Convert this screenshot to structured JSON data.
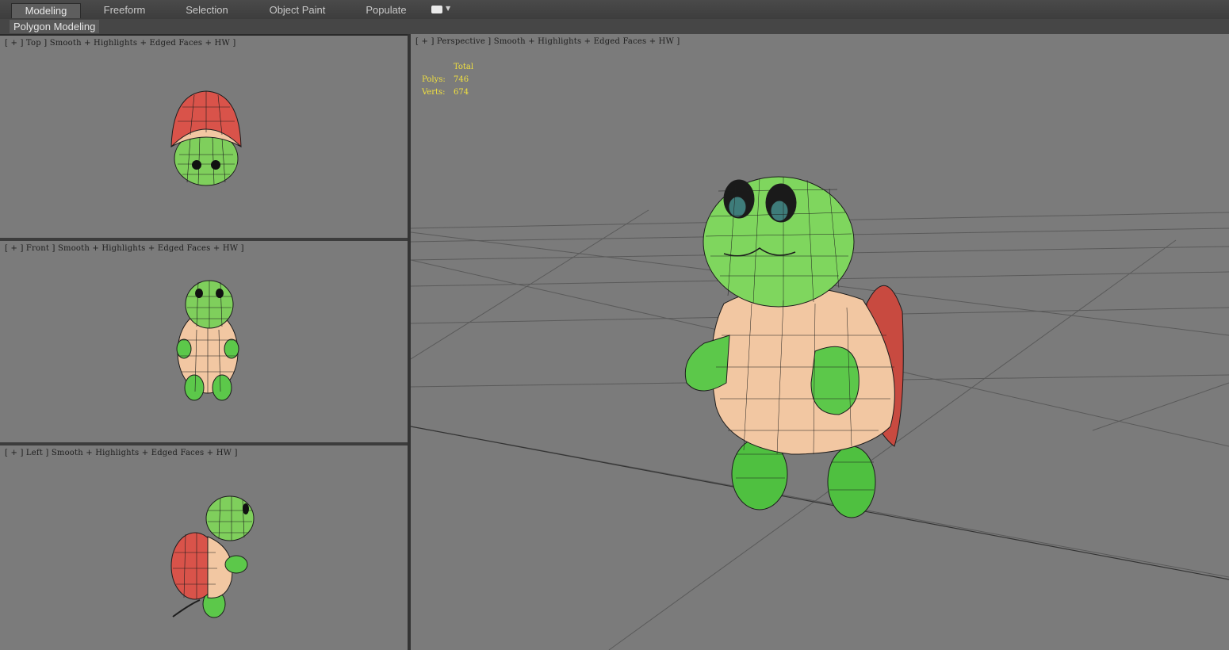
{
  "ribbon": {
    "tabs": [
      {
        "label": "Modeling",
        "active": true
      },
      {
        "label": "Freeform",
        "active": false
      },
      {
        "label": "Selection",
        "active": false
      },
      {
        "label": "Object Paint",
        "active": false
      },
      {
        "label": "Populate",
        "active": false
      }
    ],
    "panel_label": "Polygon Modeling"
  },
  "viewports": {
    "top": {
      "label": "[ + ] Top ] Smooth + Highlights + Edged Faces + HW ]"
    },
    "front": {
      "label": "[ + ] Front ] Smooth + Highlights + Edged Faces + HW ]"
    },
    "left": {
      "label": "[ + ] Left ] Smooth + Highlights + Edged Faces + HW ]"
    },
    "perspective": {
      "label": "[ + ] Perspective ] Smooth + Highlights + Edged Faces + HW ]",
      "stats": {
        "header": "Total",
        "polys_label": "Polys:",
        "polys_value": "746",
        "verts_label": "Verts:",
        "verts_value": "674"
      }
    }
  },
  "colors": {
    "viewport_bg": "#7b7b7b",
    "stats_text": "#f0e040",
    "turtle_skin": "#5cc84a",
    "turtle_shell_top": "#d9534a",
    "turtle_belly": "#f2c7a2"
  }
}
